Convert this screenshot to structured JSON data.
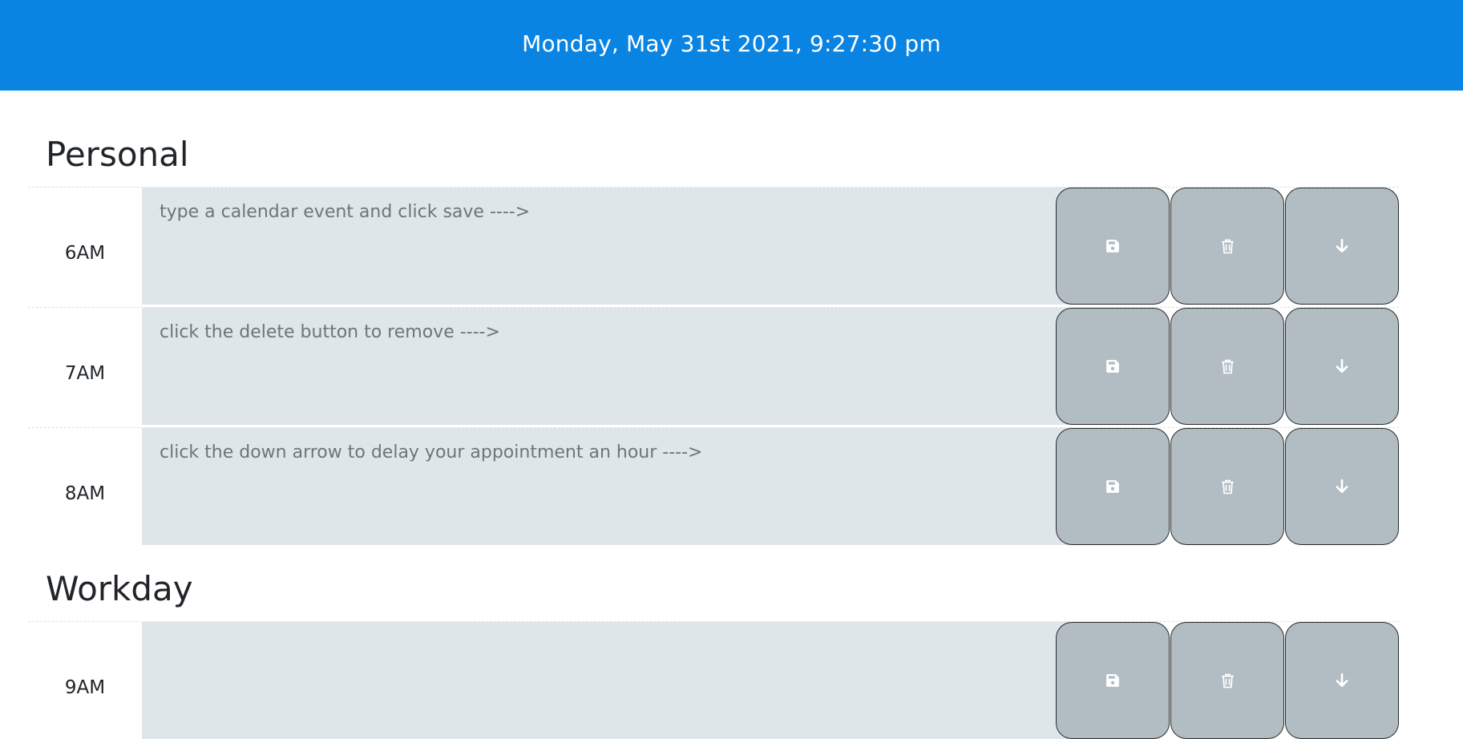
{
  "header": {
    "datetime": "Monday, May 31st 2021, 9:27:30 pm"
  },
  "sections": [
    {
      "title": "Personal",
      "rows": [
        {
          "hour": "6AM",
          "placeholder": "type a calendar event and click save ---->",
          "value": ""
        },
        {
          "hour": "7AM",
          "placeholder": "click the delete button to remove ---->",
          "value": ""
        },
        {
          "hour": "8AM",
          "placeholder": "click the down arrow to delay your appointment an hour ---->",
          "value": ""
        }
      ]
    },
    {
      "title": "Workday",
      "rows": [
        {
          "hour": "9AM",
          "placeholder": "",
          "value": ""
        }
      ]
    }
  ],
  "icons": {
    "save": "floppy-disk-icon",
    "delete": "trash-icon",
    "delay": "arrow-down-icon"
  },
  "colors": {
    "header_bg": "#0a84e2",
    "event_bg": "#dfe6e9",
    "button_bg": "#b2bcc3"
  }
}
